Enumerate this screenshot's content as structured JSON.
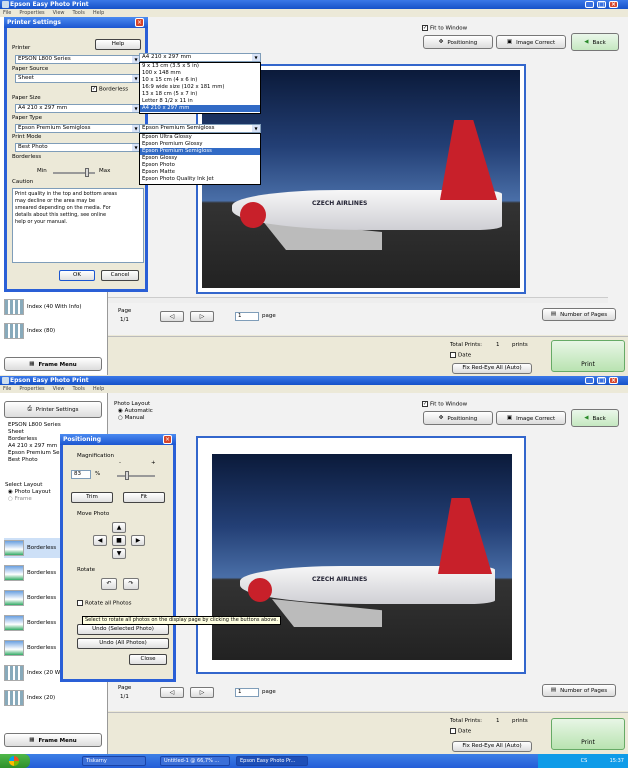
{
  "app_title": "Epson Easy Photo Print",
  "menu": [
    "File",
    "Properties",
    "View",
    "Tools",
    "Help"
  ],
  "fit_to_window": "Fit to Window",
  "positioning_btn": "Positioning",
  "image_correct_btn": "Image Correct",
  "back_btn": "Back",
  "page_label": "Page",
  "page_of": "1/1",
  "page_value": "1",
  "page_unit": "page",
  "number_of_pages_btn": "Number of Pages",
  "total_prints_label": "Total Prints:",
  "total_prints_value": "1",
  "prints_unit": "prints",
  "date_label": "Date",
  "fix_red_eye_btn": "Fix Red-Eye All (Auto)",
  "print_btn": "Print",
  "frame_menu_btn": "Frame Menu",
  "printer_settings_btn": "Printer Settings",
  "shot1": {
    "left_thumbs": [
      "Index (40 With Info)",
      "Index (80)"
    ],
    "dlg": {
      "title": "Printer Settings",
      "help_btn": "Help",
      "printer_label": "Printer",
      "printer_value": "EPSON L800 Series",
      "paper_source_label": "Paper Source",
      "paper_source_value": "Sheet",
      "borderless_chk": "Borderless",
      "paper_size_label": "Paper Size",
      "paper_size_value": "A4 210 x 297 mm",
      "paper_type_label": "Paper Type",
      "paper_type_value": "Epson Premium Semigloss",
      "print_mode_label": "Print Mode",
      "print_mode_value": "Best Photo",
      "borderless_label": "Borderless",
      "min_label": "Min",
      "max_label": "Max",
      "caution_label": "Caution",
      "caution_text": [
        "Print quality in the top and bottom areas",
        "may decline or the area may be",
        "smeared depending on the media. For",
        "details about this setting, see online",
        "help or your manual."
      ],
      "ok_btn": "OK",
      "cancel_btn": "Cancel"
    },
    "size_combo": "A4 210 x 297 mm",
    "size_options": [
      "9 x 13 cm (3.5 x 5 in)",
      "100 x 148 mm",
      "10 x 15 cm (4 x 6 in)",
      "16:9 wide size (102 x 181 mm)",
      "13 x 18 cm (5 x 7 in)",
      "Letter 8 1/2 x 11 in",
      "A4 210 x 297 mm"
    ],
    "type_combo": "Epson Premium Semigloss",
    "type_options": [
      "Epson Ultra Glossy",
      "Epson Premium Glossy",
      "Epson Premium Semigloss",
      "Epson Glossy",
      "Epson Photo",
      "Epson Matte",
      "Epson Photo Quality Ink Jet"
    ]
  },
  "shot2": {
    "photo_layout_label": "Photo Layout",
    "automatic": "Automatic",
    "manual": "Manual",
    "info": [
      "EPSON L800 Series",
      "Sheet",
      "Borderless",
      "A4 210 x 297 mm",
      "Epson Premium Se",
      "Best Photo"
    ],
    "select_layout": "Select Layout",
    "photo_layout_radio": "Photo Layout",
    "frame_radio": "Frame",
    "thumbs": [
      "Borderless",
      "Borderless",
      "Borderless",
      "Borderless",
      "Borderless",
      "Index (20 W",
      "Index (20)"
    ],
    "dlg": {
      "title": "Positioning",
      "magnification": "Magnification",
      "minus": "-",
      "plus": "+",
      "mag_value": "83",
      "percent": "%",
      "trim_btn": "Trim",
      "fit_btn": "Fit",
      "move_photo": "Move Photo",
      "rotate": "Rotate",
      "rotate_all": "Rotate all Photos",
      "undo_selected": "Undo (Selected Photo)",
      "undo_all": "Undo (All Photos)",
      "close_btn": "Close"
    },
    "tooltip": "Select to rotate all photos on the display page by clicking the buttons above."
  },
  "photo_text": "CZECH AIRLINES",
  "taskbar": {
    "items": [
      "Tiskarny",
      "Untitled-1 @ 66,7% ...",
      "Epson Easy Photo Pr..."
    ],
    "clock": "15:37",
    "lang": "CS"
  },
  "colors": {
    "accent": "#316ac5",
    "print_green": "#b9e3b1",
    "title_blue": "#1652c8"
  }
}
